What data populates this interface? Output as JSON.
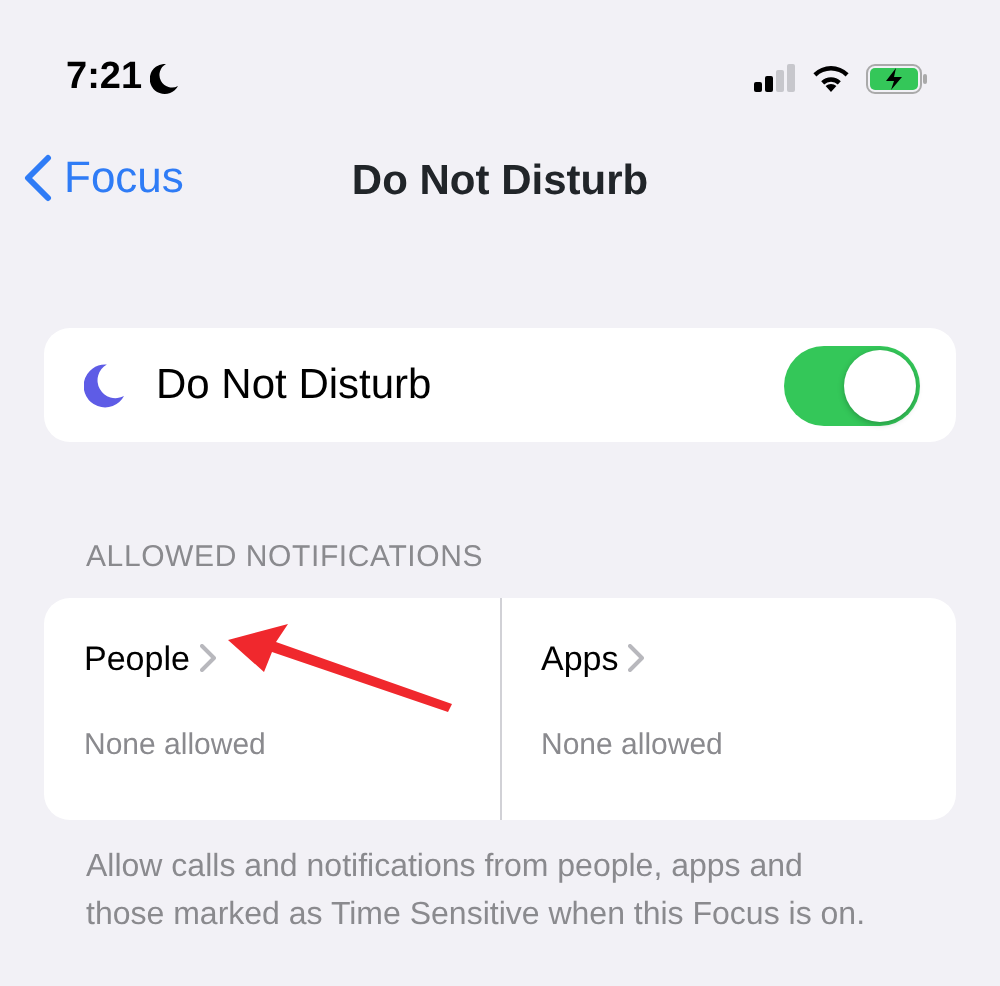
{
  "status_bar": {
    "time": "7:21"
  },
  "nav": {
    "back_label": "Focus",
    "title": "Do Not Disturb"
  },
  "toggle_row": {
    "label": "Do Not Disturb",
    "on": true
  },
  "section_header": "ALLOWED NOTIFICATIONS",
  "tiles": [
    {
      "label": "People",
      "detail": "None allowed"
    },
    {
      "label": "Apps",
      "detail": "None allowed"
    }
  ],
  "footer": "Allow calls and notifications from people, apps and those marked as Time Sensitive when this Focus is on."
}
